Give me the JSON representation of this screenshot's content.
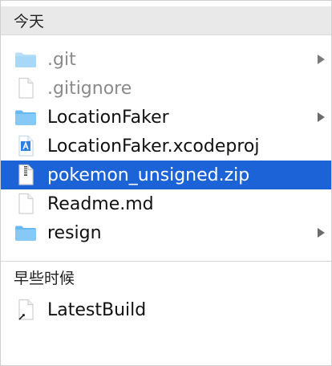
{
  "sections": {
    "today": "今天",
    "recent": "早些时候"
  },
  "today_items": [
    {
      "label": ".git",
      "icon": "folder-icon"
    },
    {
      "label": ".gitignore",
      "icon": "document-icon"
    },
    {
      "label": "LocationFaker",
      "icon": "folder-icon"
    },
    {
      "label": "LocationFaker.xcodeproj",
      "icon": "xcodeproj-icon"
    },
    {
      "label": "pokemon_unsigned.zip",
      "icon": "zip-icon"
    },
    {
      "label": "Readme.md",
      "icon": "document-icon"
    },
    {
      "label": "resign",
      "icon": "folder-icon"
    }
  ],
  "recent_items": [
    {
      "label": "LatestBuild",
      "icon": "alias-document-icon"
    }
  ],
  "colors": {
    "selection": "#1c63d8",
    "folder": "#76bff0",
    "header": "#e9e9e9"
  }
}
